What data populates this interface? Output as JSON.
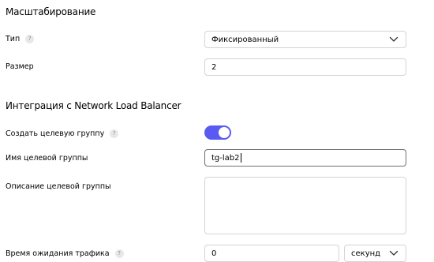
{
  "scaling": {
    "title": "Масштабирование",
    "type_label": "Тип",
    "type_value": "Фиксированный",
    "size_label": "Размер",
    "size_value": "2"
  },
  "nlb": {
    "title": "Интеграция с Network Load Balancer",
    "create_group_label": "Создать целевую группу",
    "create_group_enabled": true,
    "group_name_label": "Имя целевой группы",
    "group_name_value": "tg-lab2",
    "group_desc_label": "Описание целевой группы",
    "group_desc_value": "",
    "traffic_wait_label": "Время ожидания трафика",
    "traffic_wait_value": "0",
    "traffic_wait_unit": "секунд"
  },
  "help_glyph": "?",
  "colors": {
    "toggle_on": "#5a5af2",
    "border": "#d4d4d8",
    "help_bg": "#e8e8ea"
  },
  "icons": [
    "help-icon",
    "chevron-down-icon"
  ]
}
